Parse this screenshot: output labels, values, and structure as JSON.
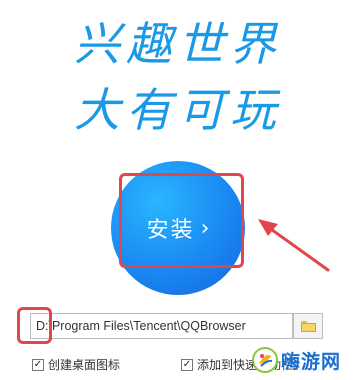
{
  "slogan": {
    "line1": "兴趣世界",
    "line2": "大有可玩"
  },
  "install": {
    "label": "安装",
    "chevron": "›"
  },
  "path": {
    "value": "D:\\Program Files\\Tencent\\QQBrowser"
  },
  "browse": {
    "icon": "folder-icon"
  },
  "options": {
    "desktop_icon": {
      "label": "创建桌面图标",
      "checked": true
    },
    "quick_launch": {
      "label": "添加到快速启动栏",
      "checked": true
    }
  },
  "annotations": {
    "highlight_color": "#e0474c"
  },
  "watermark": {
    "text": "嗨游网"
  },
  "colors": {
    "brand": "#1a9ae6",
    "button": "#1a88f2"
  }
}
